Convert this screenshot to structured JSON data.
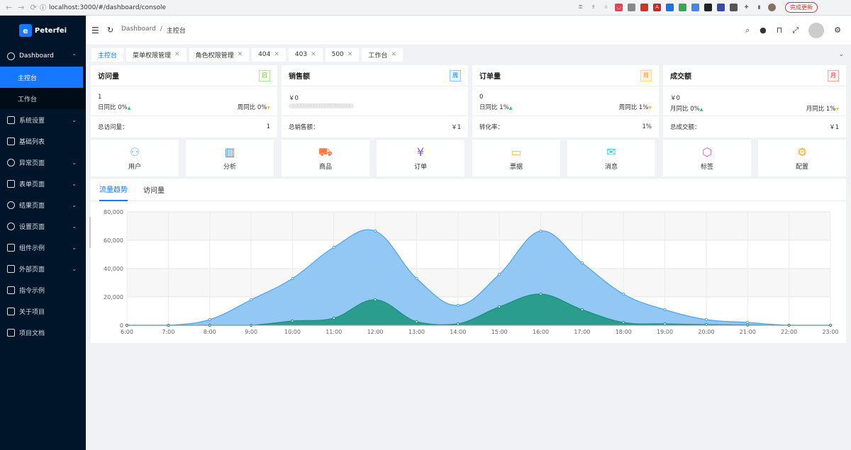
{
  "browser": {
    "url": "localhost:3000/#/dashboard/console",
    "update_label": "完成更新"
  },
  "sidebar": {
    "brand": "Peterfei",
    "items": [
      {
        "label": "Dashboard",
        "icon": "dashboard-icon",
        "open": true
      },
      {
        "label": "系统设置",
        "icon": "settings-sliders-icon"
      },
      {
        "label": "基础列表",
        "icon": "table-icon"
      },
      {
        "label": "异常页面",
        "icon": "warning-circle-icon"
      },
      {
        "label": "表单页面",
        "icon": "form-icon"
      },
      {
        "label": "结果页面",
        "icon": "check-circle-icon"
      },
      {
        "label": "设置页面",
        "icon": "gear-icon"
      },
      {
        "label": "组件示例",
        "icon": "component-icon"
      },
      {
        "label": "外部页面",
        "icon": "desktop-icon"
      },
      {
        "label": "指令示例",
        "icon": "directive-icon"
      },
      {
        "label": "关于项目",
        "icon": "project-icon"
      },
      {
        "label": "项目文档",
        "icon": "document-icon"
      }
    ],
    "sub_items": [
      {
        "label": "主控台",
        "active": true
      },
      {
        "label": "工作台",
        "active": false
      }
    ]
  },
  "header": {
    "breadcrumb_root": "Dashboard",
    "breadcrumb_sep": "/",
    "breadcrumb_current": "主控台"
  },
  "tabs": [
    {
      "label": "主控台",
      "closable": false,
      "active": true
    },
    {
      "label": "菜单权限管理",
      "closable": true
    },
    {
      "label": "角色权限管理",
      "closable": true
    },
    {
      "label": "404",
      "closable": true
    },
    {
      "label": "403",
      "closable": true
    },
    {
      "label": "500",
      "closable": true
    },
    {
      "label": "工作台",
      "closable": true
    }
  ],
  "cards": [
    {
      "title": "访问量",
      "badge": "日",
      "badge_color": "#52c41a",
      "value": "1",
      "left": "日同比 0%",
      "right": "周同比 0%",
      "footer_label": "总访问量：",
      "footer_value": "1"
    },
    {
      "title": "销售额",
      "badge": "周",
      "badge_color": "#1677ff",
      "value": "￥0",
      "progress": "0.43724611122787883314",
      "footer_label": "总销售额：",
      "footer_value": "￥1"
    },
    {
      "title": "订单量",
      "badge": "周",
      "badge_color": "#fa8c16",
      "value": "0",
      "left": "日同比 1%",
      "right": "周同比 1%",
      "footer_label": "转化率：",
      "footer_value": "1%"
    },
    {
      "title": "成交额",
      "badge": "月",
      "badge_color": "#f5222d",
      "value": "￥0",
      "left": "月同比 0%",
      "right": "月同比 1%",
      "footer_label": "总成交额：",
      "footer_value": "￥1"
    }
  ],
  "quick": [
    {
      "label": "用户",
      "icon": "user-add-icon",
      "color": "#69c0ff",
      "glyph": "⚇"
    },
    {
      "label": "分析",
      "icon": "bar-chart-icon",
      "color": "#4096ff",
      "glyph": "▥"
    },
    {
      "label": "商品",
      "icon": "shopping-cart-icon",
      "color": "#ff7a45",
      "glyph": "⛟"
    },
    {
      "label": "订单",
      "icon": "order-icon",
      "color": "#9254de",
      "glyph": "¥"
    },
    {
      "label": "票据",
      "icon": "credit-card-icon",
      "color": "#ffc53d",
      "glyph": "▭"
    },
    {
      "label": "消息",
      "icon": "mail-icon",
      "color": "#36cfc9",
      "glyph": "✉"
    },
    {
      "label": "标签",
      "icon": "tag-icon",
      "color": "#f759ab",
      "glyph": "⬡"
    },
    {
      "label": "配置",
      "icon": "settings-icon",
      "color": "#ffa940",
      "glyph": "⚙"
    }
  ],
  "chart_tabs": [
    {
      "label": "流量趋势",
      "active": true
    },
    {
      "label": "访问量",
      "active": false
    }
  ],
  "chart_data": {
    "type": "area",
    "x": [
      "6:00",
      "7:00",
      "8:00",
      "9:00",
      "10:00",
      "11:00",
      "12:00",
      "13:00",
      "14:00",
      "15:00",
      "16:00",
      "17:00",
      "18:00",
      "19:00",
      "20:00",
      "21:00",
      "22:00",
      "23:00"
    ],
    "ylim": [
      0,
      80000
    ],
    "yticks": [
      "0",
      "20,000",
      "40,000",
      "60,000",
      "80,000"
    ],
    "grid": true,
    "series": [
      {
        "values": [
          0,
          0,
          4000,
          18000,
          33000,
          55000,
          66500,
          33000,
          14000,
          36000,
          66500,
          44000,
          22000,
          11000,
          4000,
          2000,
          0,
          0
        ],
        "color": "#4fa4f0",
        "fill": "#8cc5f2"
      },
      {
        "values": [
          0,
          0,
          0,
          0,
          3000,
          5000,
          18000,
          2500,
          1000,
          13000,
          22000,
          11000,
          2000,
          1000,
          500,
          200,
          0,
          0
        ],
        "color": "#1a8f7a",
        "fill": "#2a9d8f"
      }
    ]
  }
}
